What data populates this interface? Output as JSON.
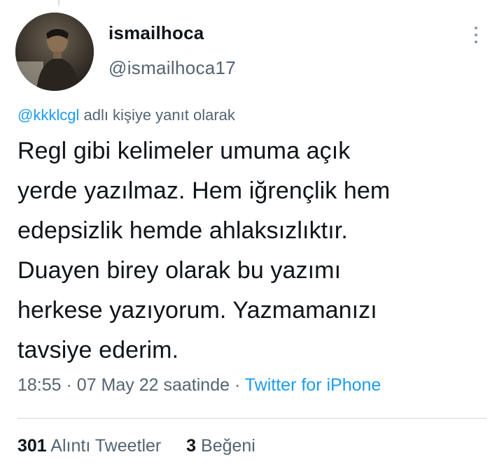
{
  "tweet": {
    "author": {
      "display_name": "ismailhoca",
      "handle": "@ismailhoca17",
      "avatar_icon": "user-photo"
    },
    "reply_to": {
      "mention": "@kkklcgl",
      "suffix": "adlı kişiye yanıt olarak"
    },
    "text_lines": [
      "Regl gibi kelimeler umuma açık",
      "yerde yazılmaz. Hem iğrençlik hem",
      "edepsizlik hemde ahlaksızlıktır.",
      "Duayen birey olarak bu yazımı",
      "herkese yazıyorum. Yazmamanızı",
      "tavsiye ederim."
    ],
    "meta": {
      "time": "18:55",
      "separator": "·",
      "date": "07 May 22 saatinde",
      "source": "Twitter for iPhone"
    },
    "stats": {
      "quote_count": "301",
      "quote_label": "Alıntı Tweetler",
      "like_count": "3",
      "like_label": "Beğeni"
    }
  },
  "colors": {
    "text": "#0f1419",
    "secondary": "#536471",
    "link": "#1d9bf0",
    "divider": "#cfd9de"
  }
}
